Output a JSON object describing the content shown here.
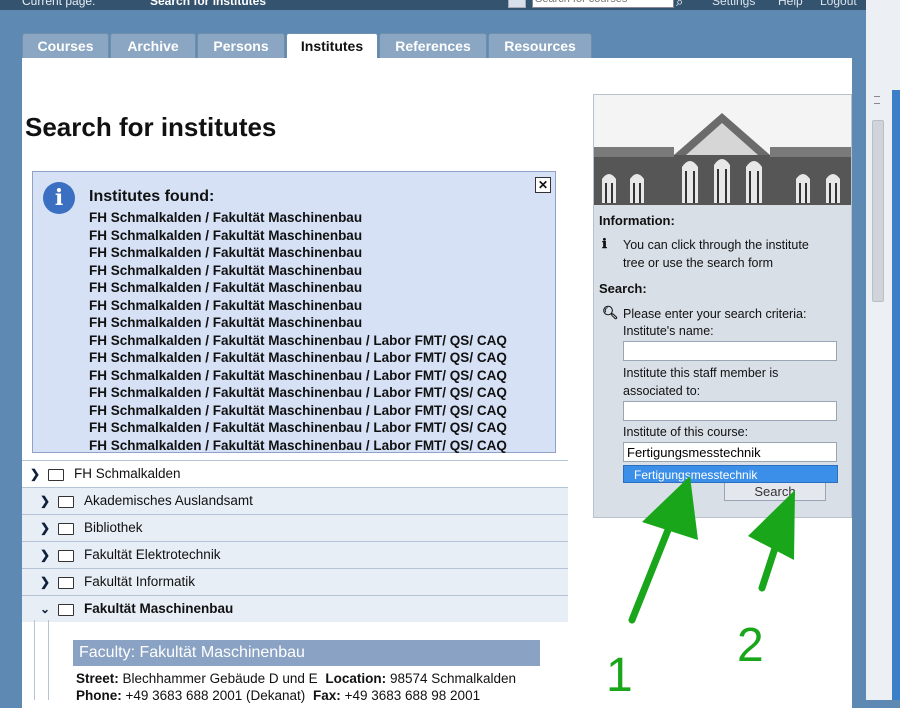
{
  "topbar": {
    "current_page_label": "Current page:",
    "current_page": "Search for institutes",
    "search_placeholder": "Search for courses",
    "links": [
      "Settings",
      "Help",
      "Logout"
    ]
  },
  "tabs": [
    "Courses",
    "Archive",
    "Persons",
    "Institutes",
    "References",
    "Resources"
  ],
  "active_tab": "Institutes",
  "page_title": "Search for institutes",
  "info_box": {
    "title": "Institutes found:",
    "results": [
      "FH Schmalkalden / Fakultät Maschinenbau",
      "FH Schmalkalden / Fakultät Maschinenbau",
      "FH Schmalkalden / Fakultät Maschinenbau",
      "FH Schmalkalden / Fakultät Maschinenbau",
      "FH Schmalkalden / Fakultät Maschinenbau",
      "FH Schmalkalden / Fakultät Maschinenbau",
      "FH Schmalkalden / Fakultät Maschinenbau",
      "FH Schmalkalden / Fakultät Maschinenbau / Labor FMT/ QS/ CAQ",
      "FH Schmalkalden / Fakultät Maschinenbau / Labor FMT/ QS/ CAQ",
      "FH Schmalkalden / Fakultät Maschinenbau / Labor FMT/ QS/ CAQ",
      "FH Schmalkalden / Fakultät Maschinenbau / Labor FMT/ QS/ CAQ",
      "FH Schmalkalden / Fakultät Maschinenbau / Labor FMT/ QS/ CAQ",
      "FH Schmalkalden / Fakultät Maschinenbau / Labor FMT/ QS/ CAQ",
      "FH Schmalkalden / Fakultät Maschinenbau / Labor FMT/ QS/ CAQ"
    ]
  },
  "tree": [
    {
      "label": "FH Schmalkalden",
      "open": false
    },
    {
      "label": "Akademisches Auslandsamt",
      "open": false
    },
    {
      "label": "Bibliothek",
      "open": false
    },
    {
      "label": "Fakultät Elektrotechnik",
      "open": false
    },
    {
      "label": "Fakultät Informatik",
      "open": false
    },
    {
      "label": "Fakultät Maschinenbau",
      "open": true
    }
  ],
  "faculty": {
    "heading": "Faculty: Fakultät Maschinenbau",
    "street_label": "Street:",
    "street": "Blechhammer Gebäude D und E",
    "location_label": "Location:",
    "location": "98574 Schmalkalden",
    "phone_label": "Phone:",
    "phone": "+49 3683 688 2001 (Dekanat)",
    "fax_label": "Fax:",
    "fax": "+49 3683 688 98 2001"
  },
  "sidebar": {
    "info_heading": "Information:",
    "info_text_1": "You can click through the institute",
    "info_text_2": "tree or use the search form",
    "search_heading": "Search:",
    "search_intro": "Please enter your search criteria:",
    "name_label": "Institute's name:",
    "name_value": "",
    "staff_label_1": "Institute this staff member is",
    "staff_label_2": "associated to:",
    "staff_value": "",
    "course_label": "Institute of this course:",
    "course_value": "Fertigungsmesstechnik",
    "autocomplete_option": "Fertigungsmesstechnik",
    "search_button": "Search"
  },
  "annotations": [
    "1",
    "2"
  ],
  "colors": {
    "annotation_green": "#1aa61a",
    "autocomplete_blue": "#3b8fe8",
    "info_bg": "#d6e1f5"
  }
}
